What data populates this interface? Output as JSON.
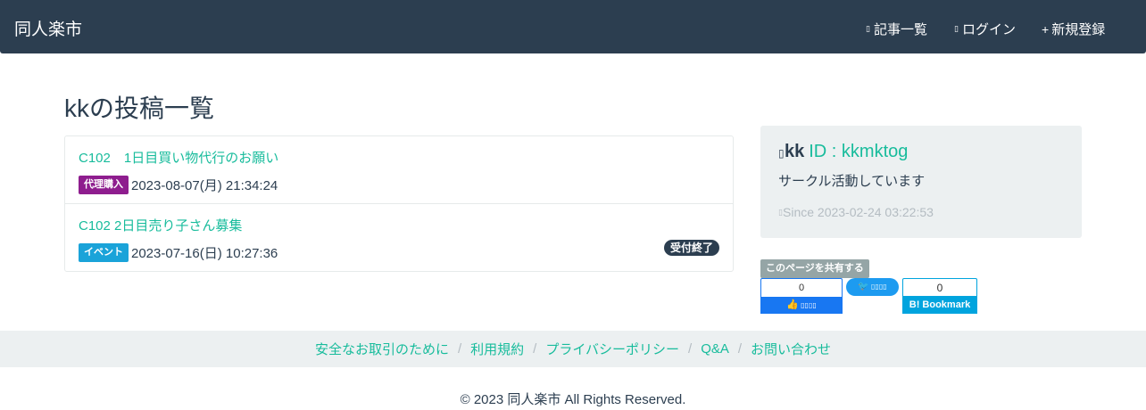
{
  "navbar": {
    "brand": "同人楽市",
    "items": [
      {
        "icon": "list-icon",
        "glyph": "▯",
        "label": "記事一覧"
      },
      {
        "icon": "login-icon",
        "glyph": "▯",
        "label": "ログイン"
      },
      {
        "icon": "plus-icon",
        "glyph": "+",
        "label": "新規登録"
      }
    ]
  },
  "page": {
    "title": "kkの投稿一覧"
  },
  "posts": [
    {
      "title": "C102　1日目買い物代行のお願い",
      "badge": "代理購入",
      "date": "2023-08-07(月) 21:34:24",
      "status": ""
    },
    {
      "title": "C102 2日目売り子さん募集",
      "badge": "イベント",
      "date": "2023-07-16(日) 10:27:36",
      "status": "受付終了"
    }
  ],
  "profile": {
    "icon_glyph": "▯",
    "name": "kk",
    "id_text": "ID : kkmktog",
    "bio": "サークル活動しています",
    "since_glyph": "▯",
    "since": "Since 2023-02-24 03:22:53"
  },
  "share": {
    "label": "このページを共有する",
    "facebook": {
      "count": "0",
      "label": "▯▯▯▯"
    },
    "twitter": {
      "label": "▯▯▯▯"
    },
    "hatena": {
      "count": "0",
      "label": "B! Bookmark"
    }
  },
  "footer": {
    "links": [
      "安全なお取引のために",
      "利用規約",
      "プライバシーポリシー",
      "Q&A",
      "お問い合わせ"
    ],
    "separator": "/",
    "copyright": "© 2023 同人楽市 All Rights Reserved."
  },
  "colors": {
    "navbar": "#2c3e50",
    "accent": "#18bc9c",
    "badge_proxy": "#8e1d8e",
    "badge_event": "#1aa3d9"
  }
}
